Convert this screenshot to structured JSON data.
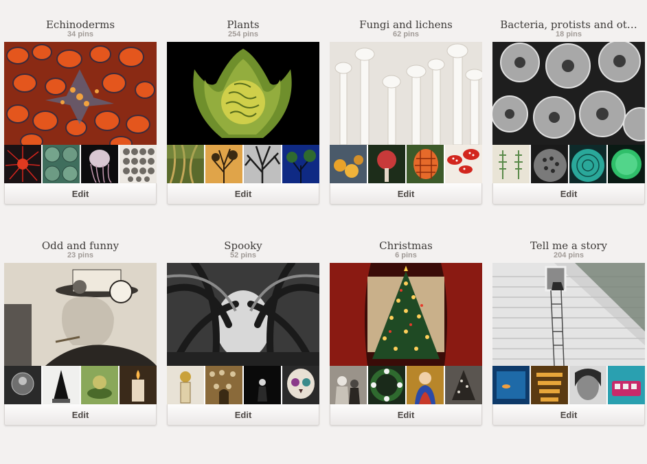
{
  "boards": [
    {
      "title": "Echinoderms",
      "pins": "34 pins",
      "edit_label": "Edit",
      "cover": "orange-starfish-closeup",
      "thumbs": [
        "red-sea-urchin",
        "green-urchin-shells",
        "jellyfish",
        "urchin-shell-collection"
      ],
      "palette": {
        "cover": "#b8421c",
        "accent": "#e9a245",
        "dark": "#222326"
      }
    },
    {
      "title": "Plants",
      "pins": "254 pins",
      "edit_label": "Edit",
      "cover": "seed-pod-in-leaves",
      "thumbs": [
        "forest-vines",
        "tree-silhouette-sunset",
        "bare-tree-bw",
        "tree-night-blue"
      ],
      "palette": {
        "cover": "#000000",
        "accent": "#b4c23d",
        "dark": "#5e7a2a"
      }
    },
    {
      "title": "Fungi and lichens",
      "pins": "62 pins",
      "edit_label": "Edit",
      "cover": "white-enoki-mushrooms",
      "thumbs": [
        "orange-mushroom-cluster",
        "red-fungus",
        "orange-lattice-fungus",
        "red-spotted-mushrooms"
      ],
      "palette": {
        "cover": "#ebe8e3",
        "accent": "#ffffff",
        "dark": "#b7b2ab"
      }
    },
    {
      "title": "Bacteria, protists and ot…",
      "pins": "18 pins",
      "edit_label": "Edit",
      "cover": "coccolithophore-micrograph",
      "thumbs": [
        "green-diatoms-drawing",
        "micrograph-honeycomb",
        "teal-diatom",
        "green-round-diatom"
      ],
      "palette": {
        "cover": "#2b2b2b",
        "accent": "#c7c7c7",
        "dark": "#111111"
      }
    },
    {
      "title": "Odd and funny",
      "pins": "23 pins",
      "edit_label": "Edit",
      "cover": "man-with-hat-gadget",
      "thumbs": [
        "fetus-sculpture",
        "black-hooded-figure",
        "green-figurine",
        "candle-figure"
      ],
      "palette": {
        "cover": "#d8d1c4",
        "accent": "#8c8577",
        "dark": "#2f2c28"
      }
    },
    {
      "title": "Spooky",
      "pins": "52 pins",
      "edit_label": "Edit",
      "cover": "twisted-tree-tunnel",
      "thumbs": [
        "skull-statue",
        "catacomb-bones",
        "dark-figure",
        "painted-skull"
      ],
      "palette": {
        "cover": "#4a4a4a",
        "accent": "#a9a9a9",
        "dark": "#1a1a1a"
      }
    },
    {
      "title": "Christmas",
      "pins": "6 pins",
      "edit_label": "Edit",
      "cover": "christmas-tree-red-curtains",
      "thumbs": [
        "vintage-santa-photo",
        "holly-wreath",
        "madonna-painting",
        "vintage-tree-photo"
      ],
      "palette": {
        "cover": "#4d0e0a",
        "accent": "#e8b04a",
        "dark": "#1d3b22"
      }
    },
    {
      "title": "Tell me a story",
      "pins": "204 pins",
      "edit_label": "Edit",
      "cover": "house-escape-ladder",
      "thumbs": [
        "aquarium-blue",
        "golden-stairs",
        "woman-portrait",
        "tram-tunnel-blue"
      ],
      "palette": {
        "cover": "#cfcfcf",
        "accent": "#f4f4f4",
        "dark": "#7a7a7a"
      }
    }
  ]
}
